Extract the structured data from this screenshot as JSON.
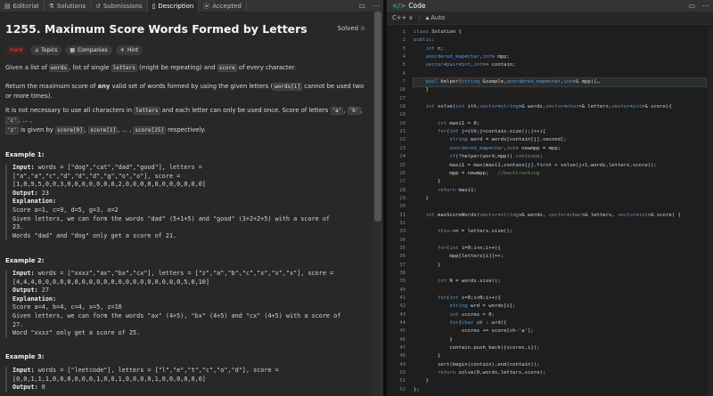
{
  "tabs": [
    {
      "icon": "editorial-icon",
      "glyph": "▤",
      "label": "Editorial"
    },
    {
      "icon": "solutions-icon",
      "glyph": "⚗",
      "label": "Solutions"
    },
    {
      "icon": "submissions-icon",
      "glyph": "↺",
      "label": "Submissions"
    },
    {
      "icon": "description-icon",
      "glyph": "▯",
      "label": "Description"
    },
    {
      "icon": "accepted-icon",
      "glyph": "⦿",
      "label": "Accepted"
    }
  ],
  "problem": {
    "title": "1255. Maximum Score Words Formed by Letters",
    "status": "Solved",
    "chips": {
      "difficulty": "Hard",
      "topics": "Topics",
      "companies": "Companies",
      "hint": "Hint"
    },
    "p1": {
      "a": "Given a list of ",
      "c1": "words",
      "b": ", list of  single ",
      "c2": "letters",
      "c": " (might be repeating) and ",
      "c3": "score",
      "d": " of every character."
    },
    "p2": {
      "a": "Return the maximum score of ",
      "bold": "any",
      "b": " valid set of words formed by using the given letters (",
      "c1": "words[i]",
      "c": " cannot be used two or more times)."
    },
    "p3": {
      "a": "It is not necessary to use all characters in ",
      "c1": "letters",
      "b": " and each letter can only be used once. Score of letters ",
      "c2": "'a'",
      ", ": ", ",
      "c3": "'b'",
      "c4": "'c'",
      "d": ", ... ,",
      "c5": "'z'",
      "e": " is given by ",
      "c6": "score[0]",
      "c7": "score[1]",
      "f": ", ... , ",
      "c8": "score[25]",
      "g": " respectively."
    }
  },
  "examples": [
    {
      "heading": "Example 1:",
      "lines": [
        {
          "k": "Input:",
          "v": " words = [\"dog\",\"cat\",\"dad\",\"good\"], letters ="
        },
        {
          "k": "",
          "v": "[\"a\",\"a\",\"c\",\"d\",\"d\",\"d\",\"g\",\"o\",\"o\"], score ="
        },
        {
          "k": "",
          "v": "[1,0,9,5,0,0,3,0,0,0,0,0,0,0,2,0,0,0,0,0,0,0,0,0,0,0]"
        },
        {
          "k": "Output:",
          "v": " 23"
        },
        {
          "k": "Explanation:",
          "v": ""
        },
        {
          "k": "",
          "v": "Score  a=1, c=9, d=5, g=3, o=2"
        },
        {
          "k": "",
          "v": "Given letters, we can form the words \"dad\" (5+1+5) and \"good\" (3+2+2+5) with a score of"
        },
        {
          "k": "",
          "v": "23."
        },
        {
          "k": "",
          "v": "Words \"dad\" and \"dog\" only get a score of 21."
        }
      ]
    },
    {
      "heading": "Example 2:",
      "lines": [
        {
          "k": "Input:",
          "v": " words = [\"xxxz\",\"ax\",\"bx\",\"cx\"], letters = [\"z\",\"a\",\"b\",\"c\",\"x\",\"x\",\"x\"], score ="
        },
        {
          "k": "",
          "v": "[4,4,4,0,0,0,0,0,0,0,0,0,0,0,0,0,0,0,0,0,0,0,0,5,0,10]"
        },
        {
          "k": "Output:",
          "v": " 27"
        },
        {
          "k": "Explanation:",
          "v": ""
        },
        {
          "k": "",
          "v": "Score  a=4, b=4, c=4, x=5, z=10"
        },
        {
          "k": "",
          "v": "Given letters, we can form the words \"ax\" (4+5), \"bx\" (4+5) and \"cx\" (4+5) with a score of"
        },
        {
          "k": "",
          "v": "27."
        },
        {
          "k": "",
          "v": "Word \"xxxz\" only get a score of 25."
        }
      ]
    },
    {
      "heading": "Example 3:",
      "lines": [
        {
          "k": "Input:",
          "v": " words = [\"leetcode\"], letters = [\"l\",\"e\",\"t\",\"c\",\"o\",\"d\"], score ="
        },
        {
          "k": "",
          "v": "[0,0,1,1,1,0,0,0,0,0,0,1,0,0,1,0,0,0,0,1,0,0,0,0,0,0]"
        },
        {
          "k": "Output:",
          "v": " 0"
        }
      ]
    }
  ],
  "code_panel": {
    "title": "Code",
    "language": "C++",
    "language_chevron": "∨",
    "mode": "Auto",
    "lines": [
      {
        "n": "1",
        "t": "class Solution {"
      },
      {
        "n": "2",
        "t": "public:"
      },
      {
        "n": "3",
        "t": "    int n;"
      },
      {
        "n": "4",
        "t": "    unordered_map<char,int> mpp;"
      },
      {
        "n": "5",
        "t": "    vector<pair<int,int>> contain;"
      },
      {
        "n": "6",
        "t": ""
      },
      {
        "n": "7",
        "t": "    bool helper(string &sample,unordered_map<char,int>& mpp){…"
      },
      {
        "n": "16",
        "t": "    }"
      },
      {
        "n": "17",
        "t": ""
      },
      {
        "n": "18",
        "t": "    int solve(int ith,vector<string>& words,vector<char>& letters,vector<int>& score){"
      },
      {
        "n": "19",
        "t": ""
      },
      {
        "n": "20",
        "t": "        int maxi1 = 0;"
      },
      {
        "n": "21",
        "t": "        for(int j=ith;j<contain.size();j++){"
      },
      {
        "n": "22",
        "t": "            string word = words[contain[j].second];"
      },
      {
        "n": "23",
        "t": "            unordered_map<char,int> newmpp = mpp;"
      },
      {
        "n": "24",
        "t": "            if(!helper(word,mpp)) continue;"
      },
      {
        "n": "25",
        "t": "            maxi1 = max(maxi1,contain[j].first + solve(j+1,words,letters,score));"
      },
      {
        "n": "26",
        "t": "            mpp = newmpp;   //backtracking"
      },
      {
        "n": "27",
        "t": "        }"
      },
      {
        "n": "28",
        "t": "        return maxi1;"
      },
      {
        "n": "29",
        "t": "    }"
      },
      {
        "n": "30",
        "t": ""
      },
      {
        "n": "31",
        "t": "    int maxScoreWords(vector<string>& words, vector<char>& letters, vector<int>& score) {"
      },
      {
        "n": "32",
        "t": ""
      },
      {
        "n": "33",
        "t": "        this->n = letters.size();"
      },
      {
        "n": "34",
        "t": ""
      },
      {
        "n": "35",
        "t": "        for(int i=0;i<n;i++){"
      },
      {
        "n": "36",
        "t": "            mpp[letters[i]]++;"
      },
      {
        "n": "37",
        "t": "        }"
      },
      {
        "n": "38",
        "t": ""
      },
      {
        "n": "39",
        "t": "        int N = words.size();"
      },
      {
        "n": "40",
        "t": ""
      },
      {
        "n": "41",
        "t": "        for(int i=0;i<N;i++){"
      },
      {
        "n": "42",
        "t": "            string wrd = words[i];"
      },
      {
        "n": "43",
        "t": "            int scores = 0;"
      },
      {
        "n": "44",
        "t": "            for(char ch : wrd){"
      },
      {
        "n": "45",
        "t": "                scores += score[ch-'a'];"
      },
      {
        "n": "46",
        "t": "            }"
      },
      {
        "n": "47",
        "t": "            contain.push_back({scores,i});"
      },
      {
        "n": "48",
        "t": "        }"
      },
      {
        "n": "49",
        "t": "        sort(begin(contain),end(contain));"
      },
      {
        "n": "50",
        "t": "        return solve(0,words,letters,score);"
      },
      {
        "n": "51",
        "t": "    }"
      },
      {
        "n": "52",
        "t": "};"
      }
    ]
  },
  "colors": {
    "accent_hard": "#ef4743",
    "solved_green": "#2cbb5d",
    "code_icon": "#2cbb5d",
    "keyword": "#569cd6",
    "type": "#4ec9b0",
    "comment": "#6a9955"
  }
}
